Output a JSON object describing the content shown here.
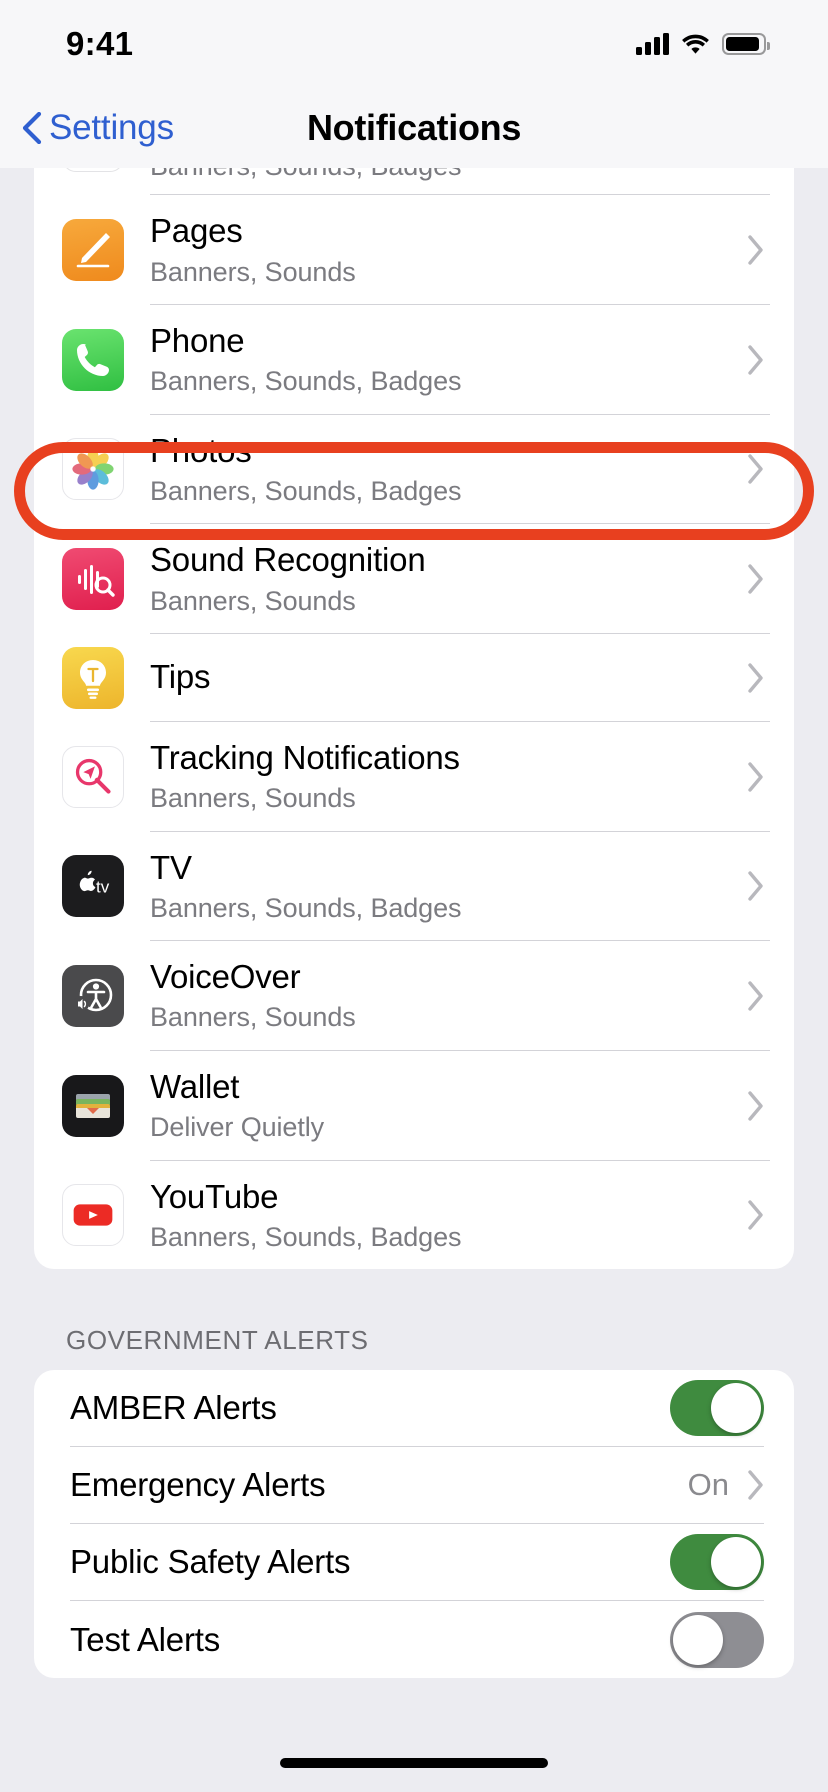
{
  "status_bar": {
    "time": "9:41",
    "signal_icon": "cellular-signal-icon",
    "wifi_icon": "wifi-icon",
    "battery_icon": "battery-icon"
  },
  "nav": {
    "back_label": "Settings",
    "back_icon": "chevron-left-icon",
    "title": "Notifications"
  },
  "apps_section": {
    "partial_top_row": {
      "subtitle": "Banners, Sounds, Badges"
    },
    "rows": [
      {
        "name": "Pages",
        "subtitle": "Banners, Sounds",
        "icon": "pages-app-icon",
        "icon_color": "#f0921f",
        "highlighted": false
      },
      {
        "name": "Phone",
        "subtitle": "Banners, Sounds, Badges",
        "icon": "phone-app-icon",
        "icon_color": "#4cd25f",
        "highlighted": false
      },
      {
        "name": "Photos",
        "subtitle": "Banners, Sounds, Badges",
        "icon": "photos-app-icon",
        "icon_color": "#ffffff",
        "highlighted": false
      },
      {
        "name": "Sound Recognition",
        "subtitle": "Banners, Sounds",
        "icon": "sound-recognition-icon",
        "icon_color": "#e8375f",
        "highlighted": true
      },
      {
        "name": "Tips",
        "subtitle": "",
        "icon": "tips-app-icon",
        "icon_color": "#f3c githubusercontent",
        "highlighted": false
      },
      {
        "name": "Tracking Notifications",
        "subtitle": "Banners, Sounds",
        "icon": "tracking-notifications-icon",
        "icon_color": "#ffffff",
        "highlighted": false
      },
      {
        "name": "TV",
        "subtitle": "Banners, Sounds, Badges",
        "icon": "apple-tv-app-icon",
        "icon_color": "#1c1c1e",
        "highlighted": false
      },
      {
        "name": "VoiceOver",
        "subtitle": "Banners, Sounds",
        "icon": "voiceover-icon",
        "icon_color": "#4a4a4c",
        "highlighted": false
      },
      {
        "name": "Wallet",
        "subtitle": "Deliver Quietly",
        "icon": "wallet-app-icon",
        "icon_color": "#1c1c1e",
        "highlighted": false
      },
      {
        "name": "YouTube",
        "subtitle": "Banners, Sounds, Badges",
        "icon": "youtube-app-icon",
        "icon_color": "#ffffff",
        "highlighted": false
      }
    ],
    "disclosure_icon": "chevron-right-icon"
  },
  "government_alerts": {
    "header": "GOVERNMENT ALERTS",
    "rows": [
      {
        "label": "AMBER Alerts",
        "control": "toggle",
        "value": "on"
      },
      {
        "label": "Emergency Alerts",
        "control": "disclosure",
        "value": "On"
      },
      {
        "label": "Public Safety Alerts",
        "control": "toggle",
        "value": "on"
      },
      {
        "label": "Test Alerts",
        "control": "toggle",
        "value": "off"
      }
    ]
  },
  "annotation": {
    "type": "red-oval-highlight",
    "target": "Sound Recognition",
    "color": "#e8401f"
  },
  "colors": {
    "page_background": "#ececf1",
    "card_background": "#ffffff",
    "accent_blue": "#2f5fd0",
    "toggle_on": "#3f8b3f",
    "toggle_off": "#8e8e93",
    "secondary_text": "#7b7b80",
    "annotation_red": "#e8401f"
  }
}
